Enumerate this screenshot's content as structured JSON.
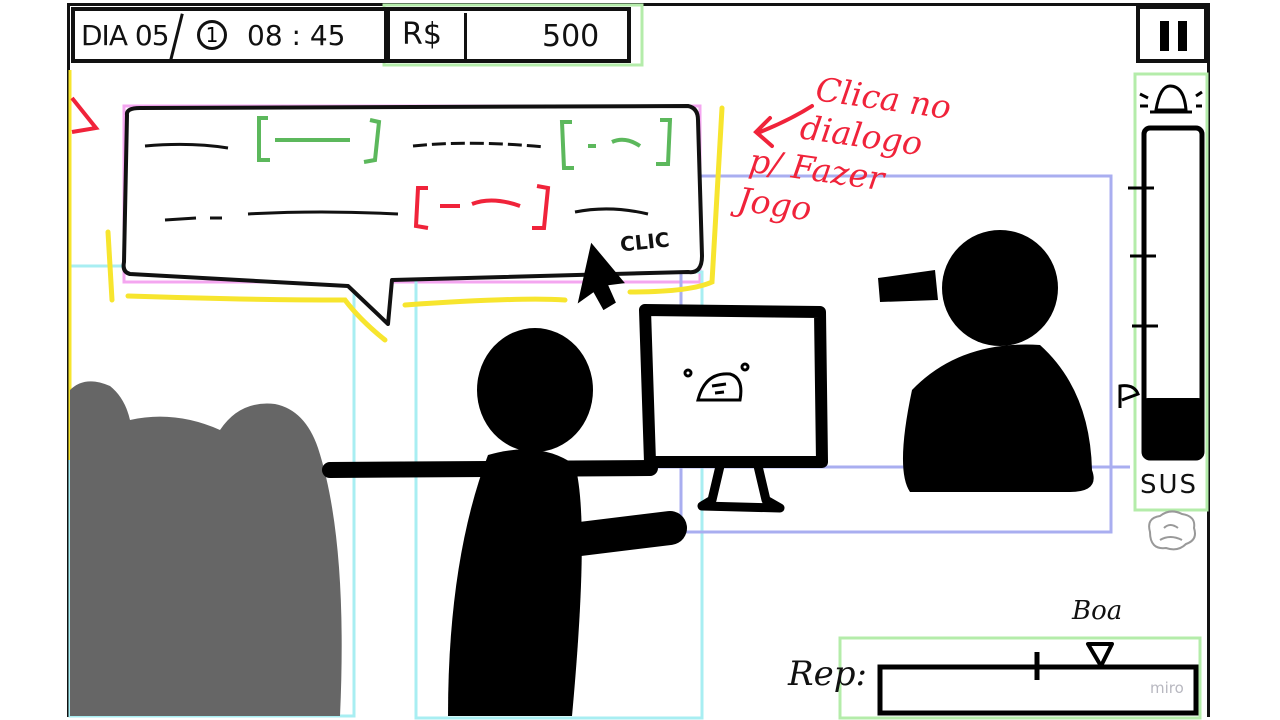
{
  "hud": {
    "day": "DIA 05",
    "clock_symbol": "1",
    "time": "08 : 45",
    "currency": "R$",
    "money": "500",
    "pause_icon": "pause-icon"
  },
  "dialog": {
    "click_label": "CLIC",
    "annotation": [
      "Clica no",
      "dialogo",
      "p/ Fazer",
      "Jogo"
    ]
  },
  "meter": {
    "alarm_icon": "alarm-light-icon",
    "label": "SUS",
    "brain_icon": "brain-icon"
  },
  "reputation": {
    "label": "Rep:",
    "marker_label": "Boa"
  },
  "watermark": "miro",
  "colors": {
    "green_bracket": "#5cb85c",
    "red_accent": "#f0233a",
    "yellow_outline": "#f7e52e",
    "pink_guide": "#f4a6f0",
    "cyan_guide": "#a8eef2",
    "blue_guide": "#a9aef0",
    "green_guide": "#b4ecaa",
    "silhouette": "#000000",
    "crowd_gray": "#666666"
  }
}
